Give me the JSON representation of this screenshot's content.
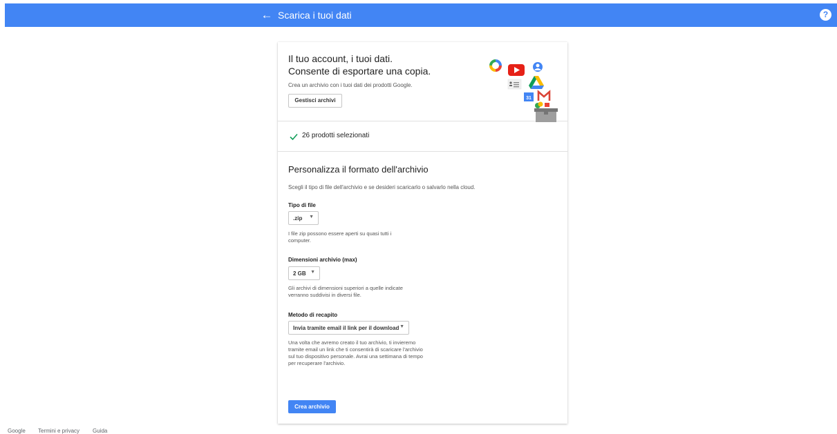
{
  "header": {
    "back_icon": "arrow-left-icon",
    "title": "Scarica i tuoi dati",
    "help_icon": "question-circle-icon",
    "help_glyph": "?"
  },
  "intro": {
    "title_line1": "Il tuo account, i tuoi dati.",
    "title_line2": "Consente di esportare una copia.",
    "description": "Crea un archivio con i tuoi dati dei prodotti Google.",
    "manage_button": "Gestisci archivi",
    "illustration_icons": [
      "photos-icon",
      "youtube-icon",
      "contacts-icon",
      "contacts-card-icon",
      "drive-icon",
      "calendar-icon",
      "gmail-icon",
      "archive-box-icon"
    ],
    "calendar_label": "31"
  },
  "selection": {
    "check_icon": "checkmark-icon",
    "text": "26 prodotti selezionati"
  },
  "format": {
    "title": "Personalizza il formato dell'archivio",
    "description": "Scegli il tipo di file dell'archivio e se desideri scaricarlo o salvarlo nella cloud.",
    "file_type": {
      "label": "Tipo di file",
      "value": ".zip",
      "help": "I file zip possono essere aperti su quasi tutti i computer."
    },
    "archive_size": {
      "label": "Dimensioni archivio (max)",
      "value": "2 GB",
      "help": "Gli archivi di dimensioni superiori a quelle indicate verranno suddivisi in diversi file."
    },
    "delivery": {
      "label": "Metodo di recapito",
      "value": "Invia tramite email il link per il download",
      "help": "Una volta che avremo creato il tuo archivio, ti invieremo tramite email un link che ti consentirà di scaricare l'archivio sul tuo dispositivo personale. Avrai una settimana di tempo per recuperare l'archivio."
    },
    "caret_icon": "triangle-down-icon",
    "caret_glyph": "▼",
    "create_button": "Crea archivio"
  },
  "footer": {
    "links": [
      "Google",
      "Termini e privacy",
      "Guida"
    ]
  },
  "colors": {
    "primary": "#4285f4",
    "check": "#0f9d58"
  }
}
